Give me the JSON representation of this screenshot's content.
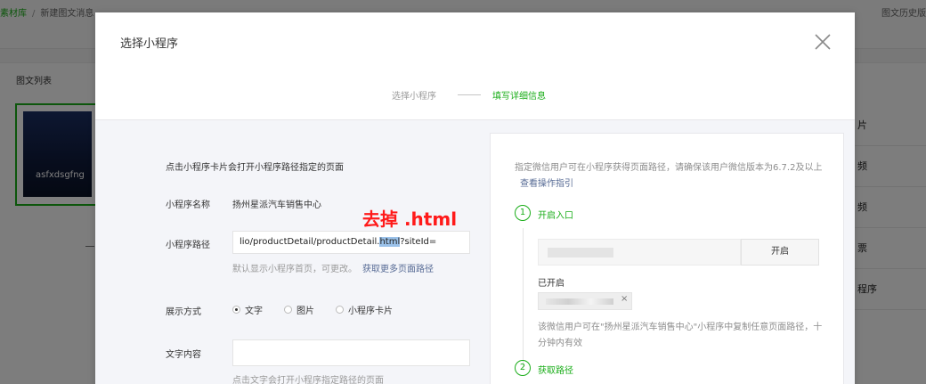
{
  "background": {
    "breadcrumb": {
      "link": "素材库",
      "separator": "/",
      "current": "新建图文消息"
    },
    "history_link": "图文历史版",
    "list_title": "图文列表",
    "article_card_title": "asfxdsgfng",
    "right_menu": [
      "片",
      "频",
      "频",
      "票",
      "程序"
    ]
  },
  "dialog": {
    "title": "选择小程序",
    "close_icon": "close-icon",
    "steps": {
      "step1": "选择小程序",
      "step2": "填写详细信息"
    },
    "form": {
      "description": "点击小程序卡片会打开小程序路径指定的页面",
      "name_label": "小程序名称",
      "name_value": "扬州星派汽车销售中心",
      "path_label": "小程序路径",
      "path_before": "lio/productDetail/productDetail.",
      "path_selected": "html",
      "path_after": "?siteId=",
      "path_tip": "默认显示小程序首页，可更改。",
      "path_tip_link": "获取更多页面路径",
      "display_label": "展示方式",
      "display_options": [
        "文字",
        "图片",
        "小程序卡片"
      ],
      "display_selected": "文字",
      "text_label": "文字内容",
      "text_value": "",
      "text_tip": "点击文字会打开小程序指定路径的页面"
    },
    "annotation": "去掉 .html",
    "guide": {
      "description": "指定微信用户可在小程序获得页面路径，请确保该用户微信版本为6.7.2及以上",
      "description_link": "查看操作指引",
      "step1_number": "1",
      "step1_label": "开启入口",
      "open_button": "开启",
      "opened_label": "已开启",
      "opened_tag_close": "×",
      "opened_note": "该微信用户可在\"扬州星派汽车销售中心\"小程序中复制任意页面路径，十分钟内有效",
      "step2_number": "2",
      "step2_label": "获取路径"
    }
  },
  "colors": {
    "accent": "#1aad19",
    "link": "#576b95",
    "annotation": "#ff1a1a",
    "selection": "#9bc2ea"
  }
}
